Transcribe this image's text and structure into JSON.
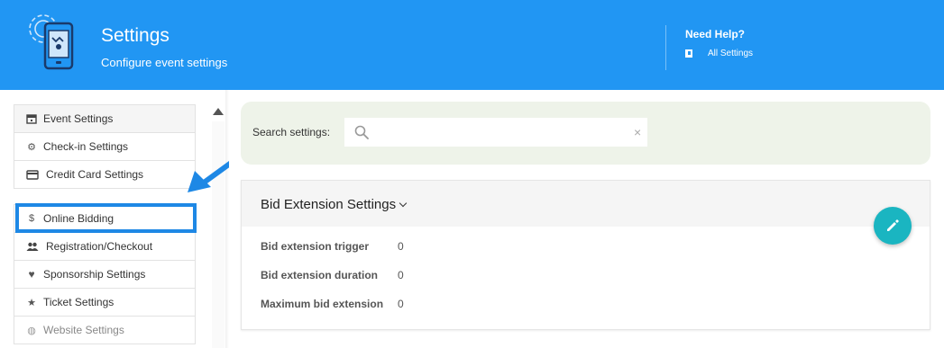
{
  "header": {
    "title": "Settings",
    "subtitle": "Configure event settings",
    "help_title": "Need Help?",
    "help_link": "All Settings",
    "logo_icon": "settings-phone-icon",
    "help_icon": "book-icon"
  },
  "sidebar": {
    "groups": [
      {
        "items": [
          {
            "label": "Event Settings",
            "icon": "calendar-icon",
            "active": true
          },
          {
            "label": "Check-in Settings",
            "icon": "gear-icon"
          },
          {
            "label": "Credit Card Settings",
            "icon": "credit-card-icon"
          }
        ]
      },
      {
        "items": [
          {
            "label": "Online Bidding",
            "icon": "dollar-icon",
            "highlighted": true
          },
          {
            "label": "Registration/Checkout",
            "icon": "people-icon"
          },
          {
            "label": "Sponsorship Settings",
            "icon": "heart-handshake-icon"
          },
          {
            "label": "Ticket Settings",
            "icon": "star-icon"
          },
          {
            "label": "Website Settings",
            "icon": "globe-icon"
          }
        ]
      }
    ]
  },
  "search": {
    "label": "Search settings:",
    "value": "",
    "placeholder": ""
  },
  "card": {
    "title": "Bid Extension Settings",
    "rows": [
      {
        "label": "Bid extension trigger",
        "value": "0"
      },
      {
        "label": "Bid extension duration",
        "value": "0"
      },
      {
        "label": "Maximum bid extension",
        "value": "0"
      }
    ],
    "edit_icon": "pencil-icon"
  },
  "colors": {
    "header_bg": "#2196f3",
    "highlight_border": "#1e88e5",
    "fab_bg": "#1ab5c1",
    "search_panel_bg": "#eef3e9"
  }
}
